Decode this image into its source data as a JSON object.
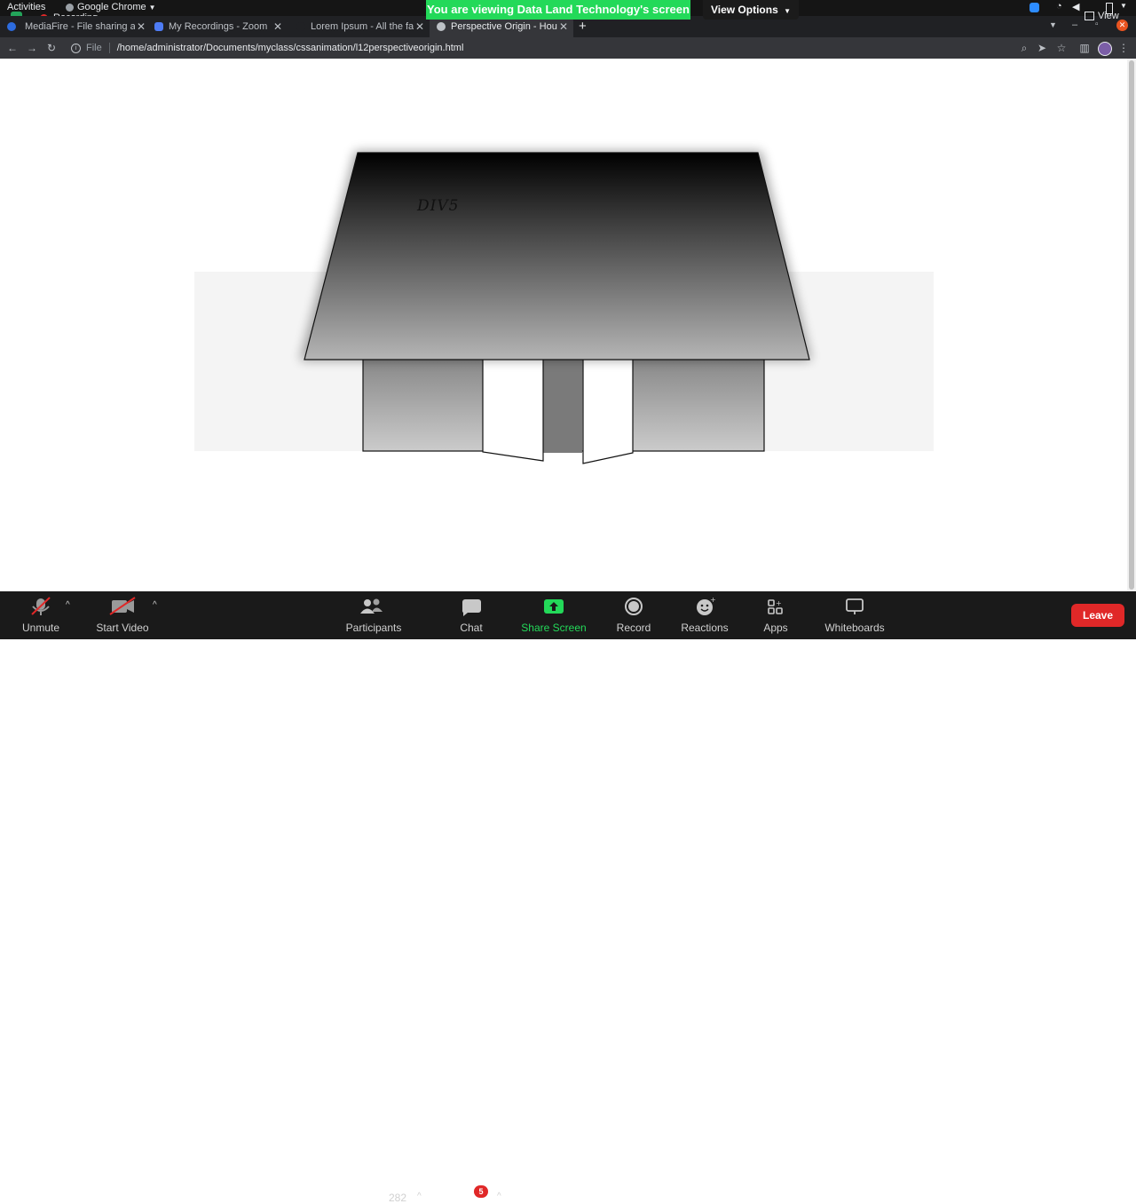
{
  "os_bar": {
    "activities": "Activities",
    "app_menu": "Google Chrome",
    "recording": "Recording",
    "view_label": "View"
  },
  "zoom_banner": {
    "viewing_text": "You are viewing Data Land Technology's screen",
    "view_options": "View Options"
  },
  "tabs": [
    {
      "label": "MediaFire - File sharing and",
      "active": false
    },
    {
      "label": "My Recordings - Zoom",
      "active": false
    },
    {
      "label": "Lorem Ipsum - All the facts",
      "active": false
    },
    {
      "label": "Perspective Origin - House",
      "active": true
    }
  ],
  "address_bar": {
    "scheme_label": "File",
    "url": "/home/administrator/Documents/myclass/cssanimation/l12perspectiveorigin.html"
  },
  "page": {
    "roof_label": "DIV5"
  },
  "zoom_controls": {
    "unmute": "Unmute",
    "start_video": "Start Video",
    "participants": "Participants",
    "participant_count": "282",
    "chat": "Chat",
    "chat_badge": "5",
    "share_screen": "Share Screen",
    "record": "Record",
    "reactions": "Reactions",
    "apps": "Apps",
    "whiteboards": "Whiteboards",
    "leave": "Leave"
  },
  "colors": {
    "banner_green": "#23d959",
    "leave_red": "#e02828",
    "chat_badge_red": "#e02828",
    "share_green": "#23d959"
  }
}
